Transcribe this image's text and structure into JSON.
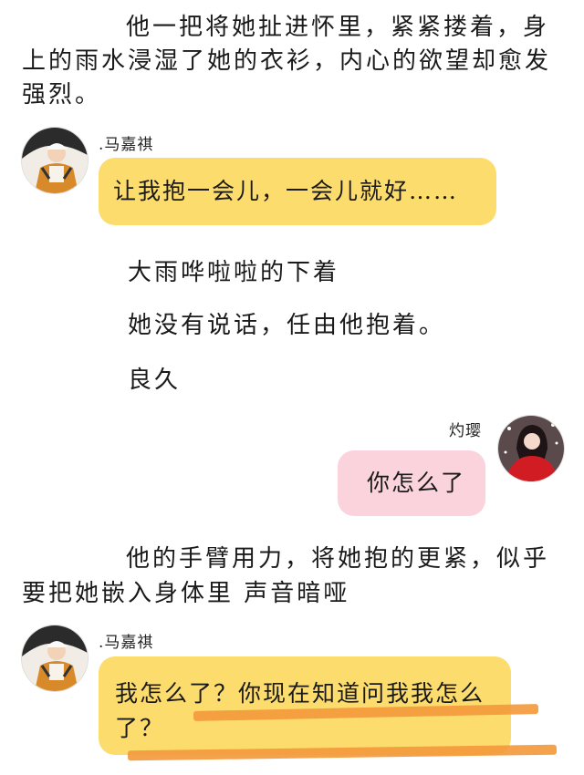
{
  "narration": {
    "para1": "他一把将她扯进怀里，紧紧搂着，身上的雨水浸湿了她的衣衫，内心的欲望却愈发强烈。",
    "line1": "大雨哗啦啦的下着",
    "line2": "她没有说话，任由他抱着。",
    "line3": "良久",
    "para2": "他的手臂用力，将她抱的更紧，似乎要把她嵌入身体里 声音暗哑"
  },
  "messages": [
    {
      "sender": ".马嘉祺",
      "text": "让我抱一会儿，一会儿就好……"
    },
    {
      "sender": "灼璎",
      "text": "你怎么了"
    },
    {
      "sender": ".马嘉祺",
      "text": "我怎么了？你现在知道问我我怎么了？"
    }
  ],
  "colors": {
    "left_bubble": "#fddc6e",
    "right_bubble": "#fbd3dc",
    "underline": "#f39a3c"
  }
}
